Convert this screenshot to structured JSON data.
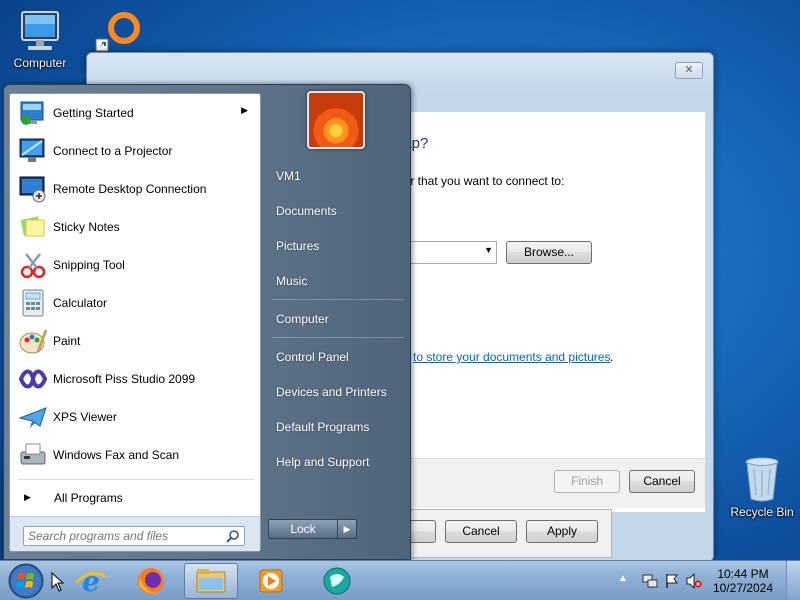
{
  "desktop": {
    "icons": [
      {
        "label": "Computer",
        "icon": "computer-icon"
      },
      {
        "label": "Recycle Bin",
        "icon": "recycle-bin-icon"
      }
    ]
  },
  "dialog": {
    "question": "nap?",
    "folder_text": "der that you want to connect to:",
    "browse_label": "Browse...",
    "store_link": "to store your documents and pictures",
    "store_link_suffix": ".",
    "finish_label": "Finish",
    "cancel_label": "Cancel",
    "close_symbol": "✕"
  },
  "dialog2": {
    "cancel_label": "Cancel",
    "apply_label": "Apply"
  },
  "start_menu": {
    "programs": [
      {
        "label": "Getting Started",
        "icon": "getting-started-icon",
        "has_submenu": true
      },
      {
        "label": "Connect to a Projector",
        "icon": "projector-icon"
      },
      {
        "label": "Remote Desktop Connection",
        "icon": "remote-desktop-icon"
      },
      {
        "label": "Sticky Notes",
        "icon": "sticky-notes-icon"
      },
      {
        "label": "Snipping Tool",
        "icon": "snipping-tool-icon"
      },
      {
        "label": "Calculator",
        "icon": "calculator-icon"
      },
      {
        "label": "Paint",
        "icon": "paint-icon"
      },
      {
        "label": "Microsoft Piss Studio 2099",
        "icon": "visual-studio-icon"
      },
      {
        "label": "XPS Viewer",
        "icon": "xps-viewer-icon"
      },
      {
        "label": "Windows Fax and Scan",
        "icon": "fax-scan-icon"
      }
    ],
    "all_programs": "All Programs",
    "search_placeholder": "Search programs and files",
    "right_items": {
      "user": "VM1",
      "documents": "Documents",
      "pictures": "Pictures",
      "music": "Music",
      "computer": "Computer",
      "control_panel": "Control Panel",
      "devices_printers": "Devices and Printers",
      "default_programs": "Default Programs",
      "help_support": "Help and Support"
    },
    "lock_label": "Lock",
    "lock_arrow": "▶"
  },
  "taskbar": {
    "pinned": [
      "start-orb-icon",
      "internet-explorer-icon",
      "firefox-icon",
      "windows-explorer-icon",
      "media-player-icon",
      "app-icon"
    ],
    "clock_time": "10:44 PM",
    "clock_date": "10/27/2024"
  }
}
